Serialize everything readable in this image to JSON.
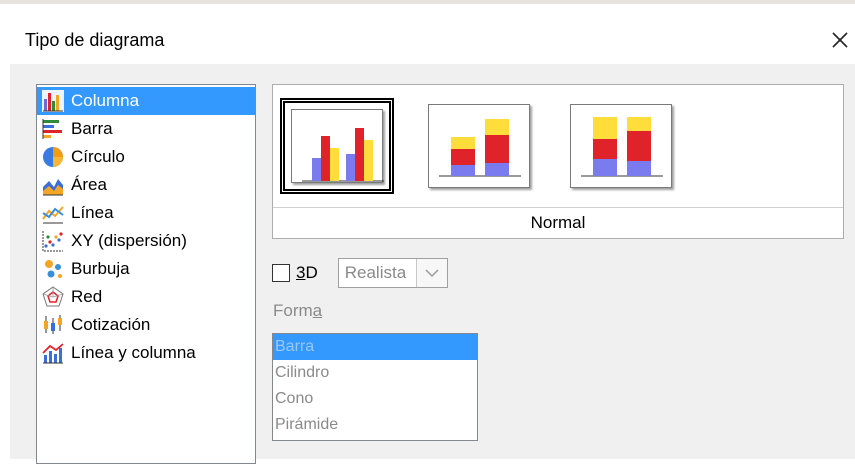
{
  "dialog": {
    "title": "Tipo de diagrama",
    "close_icon": "close-icon"
  },
  "chart_types": {
    "selected": 0,
    "items": [
      {
        "label": "Columna",
        "icon": "column-chart-icon"
      },
      {
        "label": "Barra",
        "icon": "bar-chart-icon"
      },
      {
        "label": "Círculo",
        "icon": "pie-chart-icon"
      },
      {
        "label": "Área",
        "icon": "area-chart-icon"
      },
      {
        "label": "Línea",
        "icon": "line-chart-icon"
      },
      {
        "label": "XY (dispersión)",
        "icon": "scatter-chart-icon"
      },
      {
        "label": "Burbuja",
        "icon": "bubble-chart-icon"
      },
      {
        "label": "Red",
        "icon": "net-chart-icon"
      },
      {
        "label": "Cotización",
        "icon": "stock-chart-icon"
      },
      {
        "label": "Línea y columna",
        "icon": "column-line-chart-icon"
      }
    ]
  },
  "variants": {
    "selected_caption": "Normal",
    "items": [
      {
        "name": "normal",
        "icon": "column-normal-icon"
      },
      {
        "name": "stacked",
        "icon": "column-stacked-icon"
      },
      {
        "name": "percent-stacked",
        "icon": "column-percent-stacked-icon"
      }
    ]
  },
  "options": {
    "three_d_label_prefix": "",
    "three_d_mnemonic": "3",
    "three_d_label_suffix": "D",
    "three_d_checked": false,
    "realism_value": "Realista"
  },
  "shape": {
    "label_prefix": "Form",
    "label_mnemonic": "a",
    "selected": 0,
    "items": [
      "Barra",
      "Cilindro",
      "Cono",
      "Pirámide"
    ]
  },
  "colors": {
    "selection": "#3399ff",
    "blue_series": "#7b7bf0",
    "red_series": "#e0222b",
    "yellow_series": "#ffde3b",
    "disabled_text": "#8a8a8a"
  }
}
